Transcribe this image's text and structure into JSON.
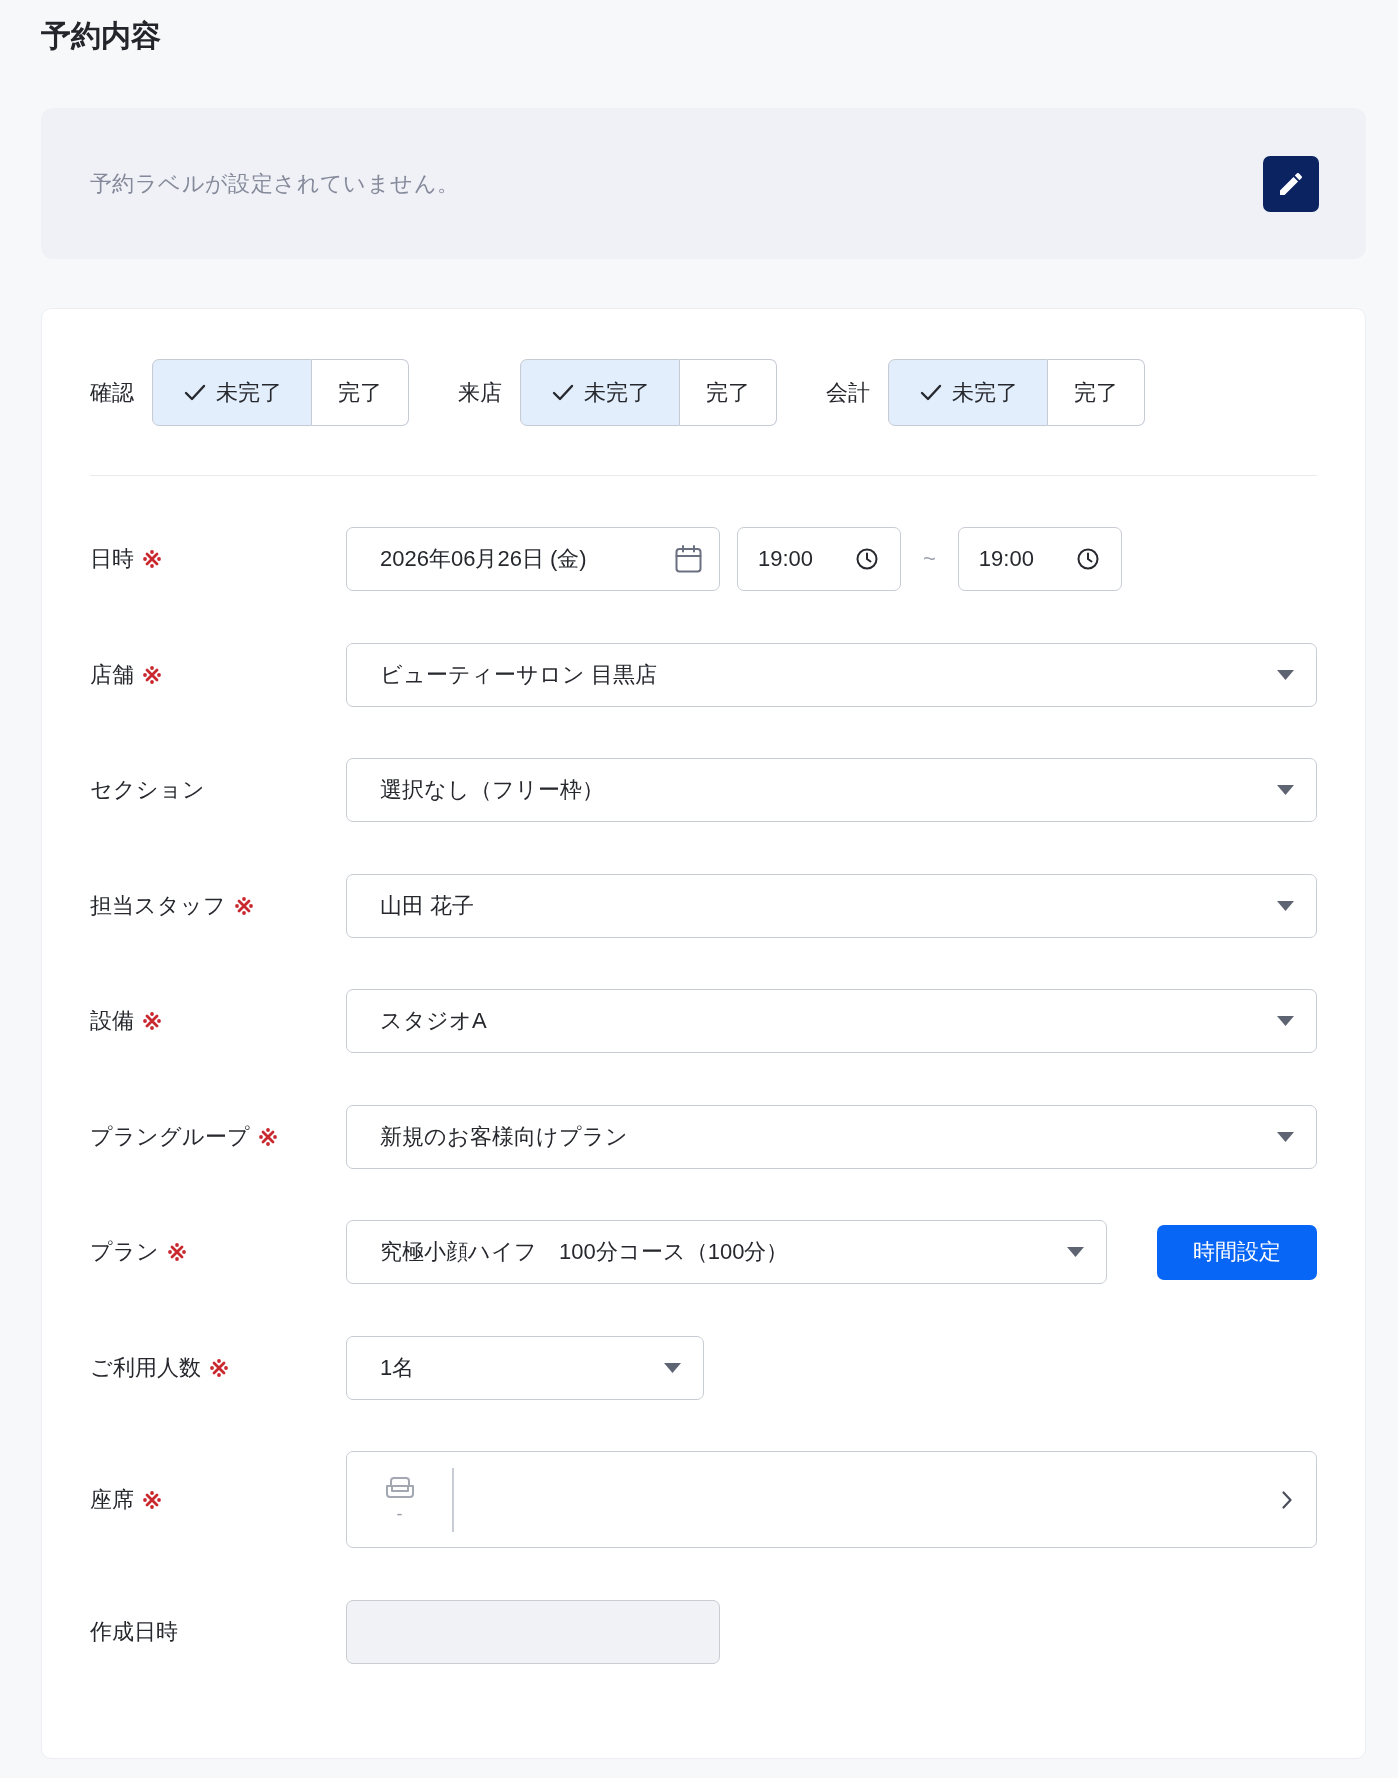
{
  "page": {
    "title": "予約内容"
  },
  "label_banner": {
    "message": "予約ラベルが設定されていません。"
  },
  "statuses": [
    {
      "label": "確認",
      "options": [
        {
          "label": "未完了",
          "selected": true
        },
        {
          "label": "完了",
          "selected": false
        }
      ]
    },
    {
      "label": "来店",
      "options": [
        {
          "label": "未完了",
          "selected": true
        },
        {
          "label": "完了",
          "selected": false
        }
      ]
    },
    {
      "label": "会計",
      "options": [
        {
          "label": "未完了",
          "selected": true
        },
        {
          "label": "完了",
          "selected": false
        }
      ]
    }
  ],
  "fields": [
    {
      "kind": "datetime",
      "label": "日時",
      "required": true,
      "date": "2026年06月26日 (金)",
      "start_time": "19:00",
      "separator": "~",
      "end_time": "19:00"
    },
    {
      "kind": "select",
      "label": "店舗",
      "required": true,
      "value": "ビューティーサロン 目黒店"
    },
    {
      "kind": "select",
      "label": "セクション",
      "required": false,
      "value": "選択なし（フリー枠）"
    },
    {
      "kind": "select",
      "label": "担当スタッフ",
      "required": true,
      "value": "山田 花子"
    },
    {
      "kind": "select",
      "label": "設備",
      "required": true,
      "value": "スタジオA"
    },
    {
      "kind": "select",
      "label": "プラングループ",
      "required": true,
      "value": "新規のお客様向けプラン"
    },
    {
      "kind": "select",
      "label": "プラン",
      "required": true,
      "value": "究極小顔ハイフ　100分コース（100分）",
      "button": "時間設定"
    },
    {
      "kind": "compact_select",
      "label": "ご利用人数",
      "required": true,
      "value": "1名"
    },
    {
      "kind": "seat_picker",
      "label": "座席",
      "required": true,
      "value": "-"
    },
    {
      "kind": "text",
      "label": "作成日時",
      "required": false,
      "disabled": true
    }
  ]
}
